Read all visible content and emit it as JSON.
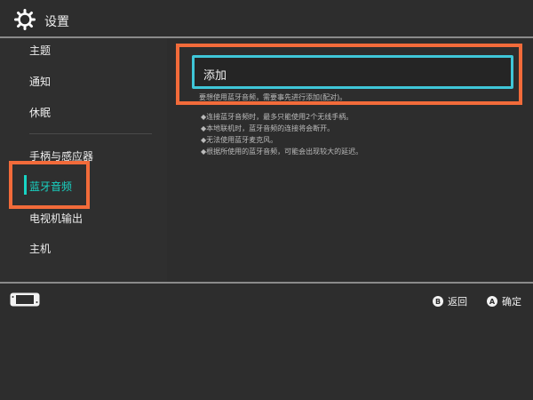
{
  "header": {
    "title": "设置",
    "icon": "gear-icon"
  },
  "sidebar": {
    "items": [
      {
        "label": "主题"
      },
      {
        "label": "通知"
      },
      {
        "label": "休眠"
      },
      {
        "label": "手柄与感应器"
      },
      {
        "label": "蓝牙音频",
        "selected": true
      },
      {
        "label": "电视机输出"
      },
      {
        "label": "主机"
      }
    ]
  },
  "main": {
    "add_label": "添加",
    "hint": "要想使用蓝牙音频，需要事先进行添加(配对)。",
    "notes": [
      "◆连接蓝牙音频时，最多只能使用2个无线手柄。",
      "◆本地联机时，蓝牙音频的连接将会断开。",
      "◆无法使用蓝牙麦克风。",
      "◆根据所使用的蓝牙音频，可能会出现较大的延迟。"
    ]
  },
  "footer": {
    "back": {
      "key": "B",
      "label": "返回"
    },
    "confirm": {
      "key": "A",
      "label": "确定"
    }
  },
  "colors": {
    "accent": "#18d4c4",
    "highlight": "#f26b3a",
    "focus": "#3fc6d8"
  }
}
